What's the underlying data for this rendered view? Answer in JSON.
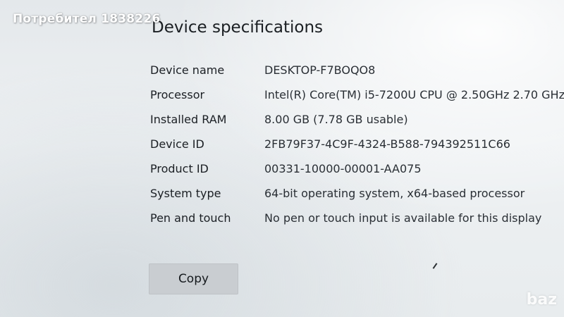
{
  "watermark": {
    "text": "Потребител 1838226"
  },
  "section": {
    "title": "Device specifications"
  },
  "specs": [
    {
      "label": "Device name",
      "value": "DESKTOP-F7BOQO8"
    },
    {
      "label": "Processor",
      "value": "Intel(R) Core(TM) i5-7200U CPU @ 2.50GHz   2.70 GHz"
    },
    {
      "label": "Installed RAM",
      "value": "8.00 GB (7.78 GB usable)"
    },
    {
      "label": "Device ID",
      "value": "2FB79F37-4C9F-4324-B588-794392511C66"
    },
    {
      "label": "Product ID",
      "value": "00331-10000-00001-AA075"
    },
    {
      "label": "System type",
      "value": "64-bit operating system, x64-based processor"
    },
    {
      "label": "Pen and touch",
      "value": "No pen or touch input is available for this display"
    }
  ],
  "actions": {
    "copy_label": "Copy"
  },
  "logo": {
    "text": "baz"
  }
}
